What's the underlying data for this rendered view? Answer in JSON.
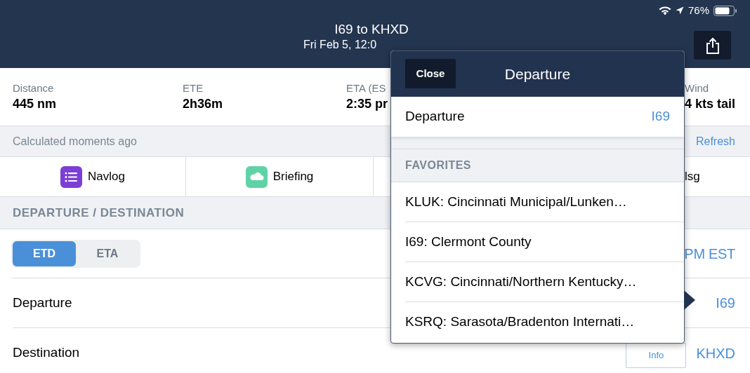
{
  "status_bar": {
    "battery": "76%"
  },
  "header": {
    "title": "I69 to KHXD",
    "subtitle": "Fri Feb 5, 12:0"
  },
  "stats": [
    {
      "label": "Distance",
      "value": "445 nm"
    },
    {
      "label": "ETE",
      "value": "2h36m"
    },
    {
      "label": "ETA (ES",
      "value": "2:35 pr"
    },
    {
      "label": "Wind",
      "value": "4 kts tail"
    }
  ],
  "calc_bar": {
    "text": "Calculated moments ago",
    "refresh": "Refresh"
  },
  "shortcuts": [
    {
      "label": "Navlog",
      "kind": "navlog"
    },
    {
      "label": "Briefing",
      "kind": "briefing"
    },
    {
      "label": "lsg",
      "kind": "plain"
    }
  ],
  "section": "DEPARTURE / DESTINATION",
  "mode_toggle": [
    {
      "label": "ETD",
      "selected": true
    },
    {
      "label": "ETA",
      "selected": false
    }
  ],
  "mode_value": "PM EST",
  "rows": [
    {
      "label": "Departure",
      "value": "I69"
    },
    {
      "label": "Destination",
      "value": "KHXD",
      "button": "Info"
    }
  ],
  "popover": {
    "close": "Close",
    "title": "Departure",
    "current": {
      "label": "Departure",
      "value": "I69"
    },
    "section": "FAVORITES",
    "items": [
      "KLUK: Cincinnati Municipal/Lunken…",
      "I69: Clermont County",
      "KCVG: Cincinnati/Northern Kentucky…",
      "KSRQ: Sarasota/Bradenton Internati…"
    ]
  }
}
